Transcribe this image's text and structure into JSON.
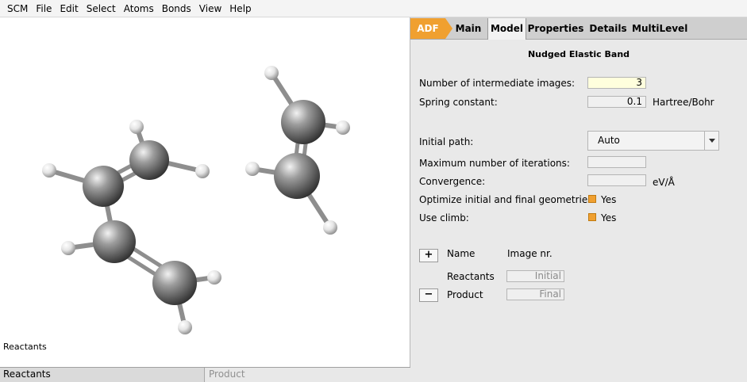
{
  "menu": [
    "SCM",
    "File",
    "Edit",
    "Select",
    "Atoms",
    "Bonds",
    "View",
    "Help"
  ],
  "viewport": {
    "label": "Reactants"
  },
  "status_tabs": [
    "Reactants",
    "Product"
  ],
  "tabs": {
    "adf": "ADF",
    "main": "Main",
    "model": "Model",
    "properties": "Properties",
    "details": "Details",
    "multilevel": "MultiLevel"
  },
  "panel": {
    "title": "Nudged Elastic Band",
    "images_label": "Number of intermediate images:",
    "images_value": "3",
    "spring_label": "Spring constant:",
    "spring_value": "0.1",
    "spring_unit": "Hartree/Bohr",
    "path_label": "Initial path:",
    "path_value": "Auto",
    "maxiter_label": "Maximum number of iterations:",
    "maxiter_value": "",
    "conv_label": "Convergence:",
    "conv_value": "",
    "conv_unit": "eV/Å",
    "optimize_label": "Optimize initial and final geometries:",
    "optimize_value": "Yes",
    "climb_label": "Use climb:",
    "climb_value": "Yes",
    "add_button": "+",
    "remove_button": "−",
    "col_name": "Name",
    "col_image": "Image nr.",
    "rows": [
      {
        "name": "Reactants",
        "image": "Initial"
      },
      {
        "name": "Product",
        "image": "Final"
      }
    ]
  },
  "colors": {
    "accent": "#f0a030",
    "highlight_field": "#ffffdd"
  }
}
